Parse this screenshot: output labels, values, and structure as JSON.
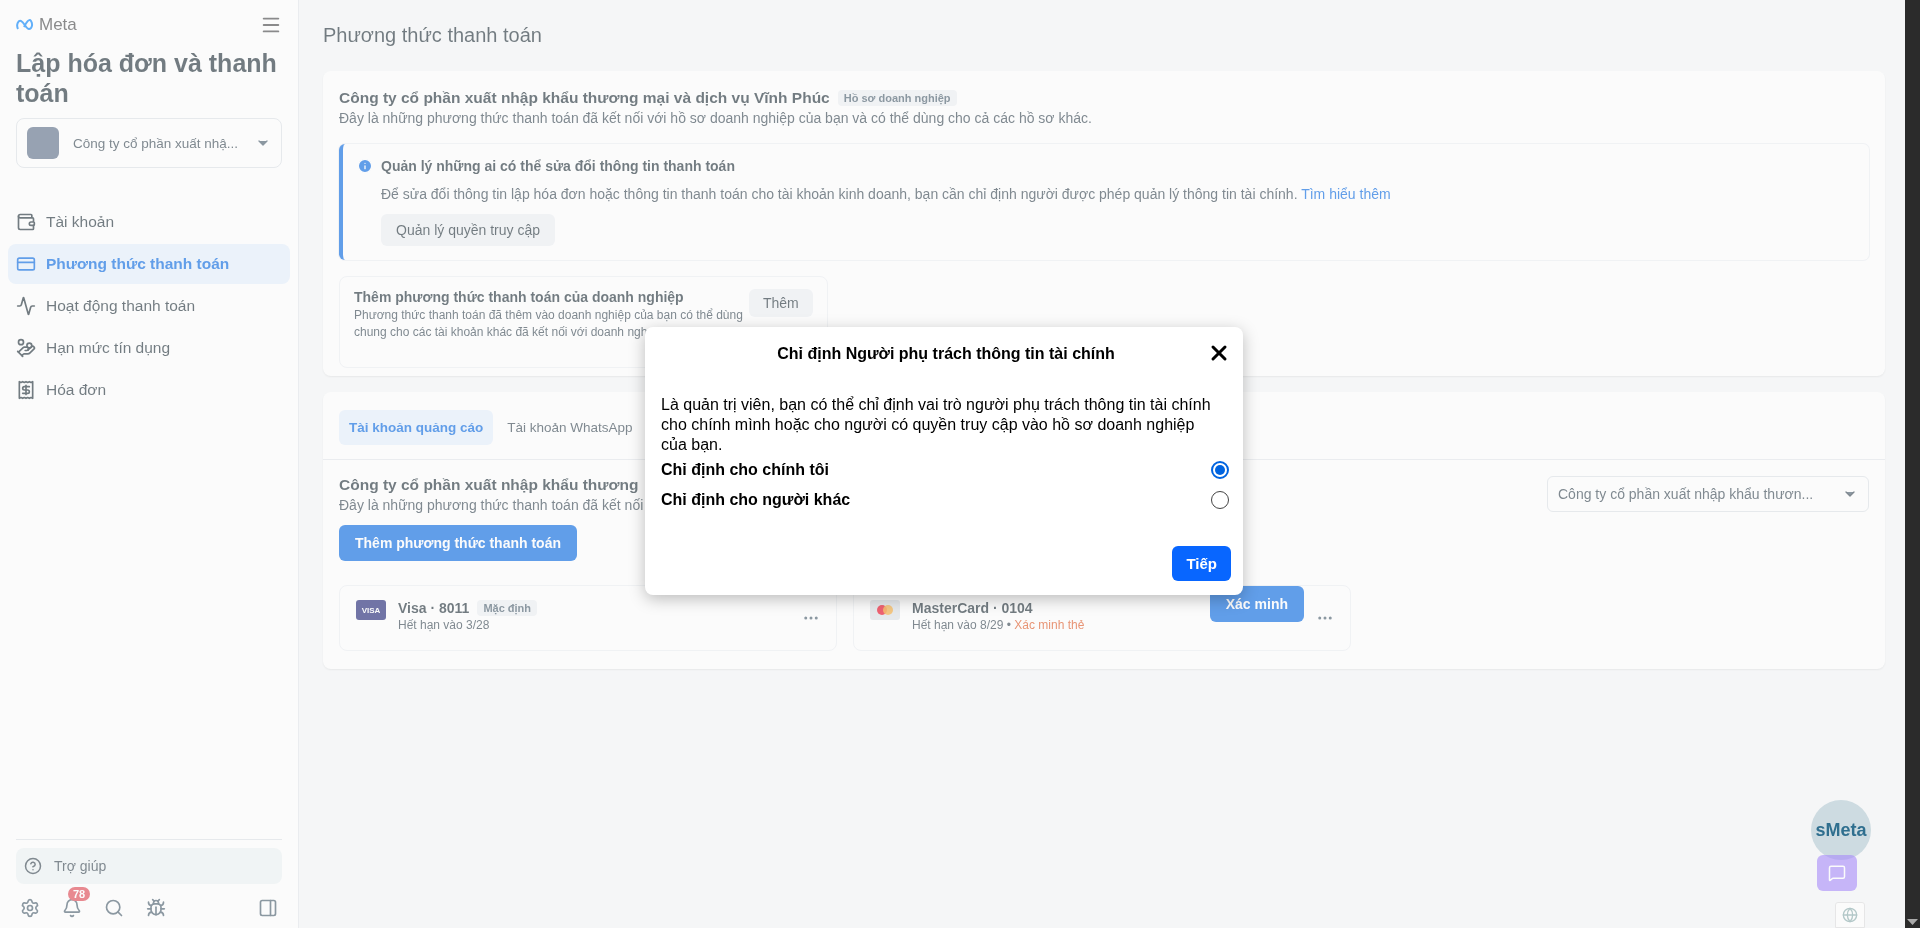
{
  "sidebar": {
    "logo": "Meta",
    "title": "Lập hóa đơn và thanh toán",
    "account": {
      "label": "Công ty cổ phần xuất nhậ..."
    },
    "nav": [
      {
        "label": "Tài khoản",
        "selected": false
      },
      {
        "label": "Phương thức thanh toán",
        "selected": true
      },
      {
        "label": "Hoạt động thanh toán",
        "selected": false
      },
      {
        "label": "Hạn mức tín dụng",
        "selected": false
      },
      {
        "label": "Hóa đơn",
        "selected": false
      }
    ],
    "help": "Trợ giúp",
    "notification_count": "78"
  },
  "main": {
    "heading": "Phương thức thanh toán",
    "business": {
      "name": "Công ty cổ phần xuất nhập khẩu thương mại và dịch vụ Vĩnh Phúc",
      "badge": "Hồ sơ doanh nghiệp",
      "description": "Đây là những phương thức thanh toán đã kết nối với hồ sơ doanh nghiệp của bạn và có thể dùng cho cả các hồ sơ khác.",
      "notice": {
        "title": "Quản lý những ai có thể sửa đổi thông tin thanh toán",
        "text": "Để sửa đổi thông tin lập hóa đơn hoặc thông tin thanh toán cho tài khoản kinh doanh, bạn cần chỉ định người được phép quản lý thông tin tài chính.",
        "link": "Tìm hiểu thêm",
        "button": "Quản lý quyền truy cập"
      },
      "add_card": {
        "title": "Thêm phương thức thanh toán của doanh nghiệp",
        "description_lines": [
          "Phương thức thanh toán đã thêm vào doanh nghiệp của bạn có thể dùng",
          "chung cho các tài khoản khác đã kết nối với doanh ngh"
        ],
        "button": "Thêm"
      }
    },
    "accounts": {
      "tabs": [
        {
          "label": "Tài khoản quảng cáo",
          "selected": true
        },
        {
          "label": "Tài khoản WhatsApp",
          "selected": false
        }
      ],
      "heading": "Công ty cổ phần xuất nhập khẩu thương",
      "description": "Đây là những phương thức thanh toán đã kết nối",
      "dropdown": "Công ty cổ phần xuất nhập khẩu thươn...",
      "add_button": "Thêm phương thức thanh toán",
      "methods": [
        {
          "kind": "visa",
          "logo": "VISA",
          "name": "Visa · 8011",
          "badge": "Mặc định",
          "expiry": "Hết hạn vào 3/28"
        },
        {
          "kind": "mastercard",
          "name": "MasterCard · 0104",
          "expiry": "Hết hạn vào 8/29",
          "separator": "•",
          "warning": "Xác minh thẻ",
          "button": "Xác minh"
        }
      ]
    }
  },
  "modal": {
    "title": "Chỉ định Người phụ trách thông tin tài chính",
    "text": "Là quản trị viên, bạn có thể chỉ định vai trò người phụ trách thông tin tài chính cho chính mình hoặc cho người có quyền truy cập vào hồ sơ doanh nghiệp của bạn.",
    "options": [
      {
        "label": "Chỉ định cho chính tôi",
        "selected": true
      },
      {
        "label": "Chỉ định cho người khác",
        "selected": false
      }
    ],
    "button": "Tiếp"
  },
  "widget": {
    "label": "sMeta"
  }
}
